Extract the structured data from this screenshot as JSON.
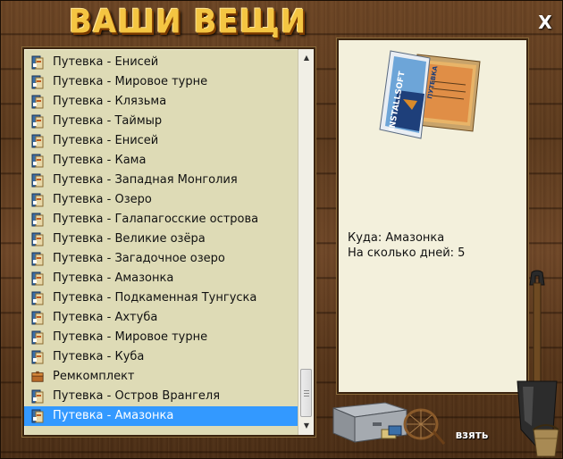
{
  "window": {
    "title": "ВАШИ ВЕЩИ",
    "close_label": "X"
  },
  "items": [
    {
      "label": "Путевка - Енисей",
      "icon": "voucher-icon"
    },
    {
      "label": "Путевка - Мировое турне",
      "icon": "voucher-icon"
    },
    {
      "label": "Путевка - Клязьма",
      "icon": "voucher-icon"
    },
    {
      "label": "Путевка - Таймыр",
      "icon": "voucher-icon"
    },
    {
      "label": "Путевка - Енисей",
      "icon": "voucher-icon"
    },
    {
      "label": "Путевка - Кама",
      "icon": "voucher-icon"
    },
    {
      "label": "Путевка - Западная Монголия",
      "icon": "voucher-icon"
    },
    {
      "label": "Путевка - Озеро",
      "icon": "voucher-icon"
    },
    {
      "label": "Путевка - Галапагосские острова",
      "icon": "voucher-icon"
    },
    {
      "label": "Путевка - Великие озёра",
      "icon": "voucher-icon"
    },
    {
      "label": "Путевка - Загадочное озеро",
      "icon": "voucher-icon"
    },
    {
      "label": "Путевка - Амазонка",
      "icon": "voucher-icon"
    },
    {
      "label": "Путевка - Подкаменная Тунгуска",
      "icon": "voucher-icon"
    },
    {
      "label": "Путевка - Ахтуба",
      "icon": "voucher-icon"
    },
    {
      "label": "Путевка - Мировое турне",
      "icon": "voucher-icon"
    },
    {
      "label": "Путевка - Куба",
      "icon": "voucher-icon"
    },
    {
      "label": "Ремкомплект",
      "icon": "repair-kit-icon"
    },
    {
      "label": "Путевка - Остров Врангеля",
      "icon": "voucher-icon"
    },
    {
      "label": "Путевка - Амазонка",
      "icon": "voucher-icon",
      "selected": true
    }
  ],
  "detail": {
    "brochure_left_text": "INSTALLSOFT",
    "brochure_right_text": "ПУТЕВКА",
    "destination": "Куда: Амазонка",
    "days": "На сколько дней: 5"
  },
  "actions": {
    "take_label": "взять"
  },
  "colors": {
    "title": "#f4c542",
    "selection": "#3399ff",
    "list_background": "#dedbb6",
    "detail_background": "#f3f0dc"
  }
}
